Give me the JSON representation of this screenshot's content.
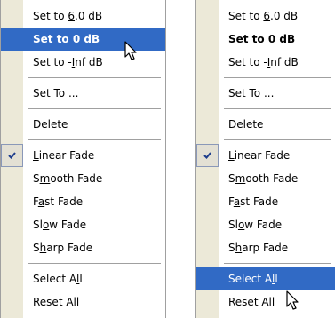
{
  "left_menu": {
    "items": [
      {
        "pre": "Set to ",
        "acc": "6",
        "post": ".0 dB"
      },
      {
        "pre": "Set to ",
        "acc": "0",
        "post": " dB"
      },
      {
        "pre": "Set to -",
        "acc": "I",
        "post": "nf dB"
      },
      {
        "pre": "Set To ...",
        "acc": "",
        "post": ""
      },
      {
        "pre": "Delete",
        "acc": "",
        "post": ""
      },
      {
        "pre": "",
        "acc": "L",
        "post": "inear Fade"
      },
      {
        "pre": "S",
        "acc": "m",
        "post": "ooth Fade"
      },
      {
        "pre": "F",
        "acc": "a",
        "post": "st Fade"
      },
      {
        "pre": "Sl",
        "acc": "o",
        "post": "w Fade"
      },
      {
        "pre": "S",
        "acc": "h",
        "post": "arp Fade"
      },
      {
        "pre": "Select A",
        "acc": "l",
        "post": "l"
      },
      {
        "pre": "Reset All",
        "acc": "",
        "post": ""
      }
    ]
  },
  "right_menu": {
    "items": [
      {
        "pre": "Set to ",
        "acc": "6",
        "post": ".0 dB"
      },
      {
        "pre": "Set to ",
        "acc": "0",
        "post": " dB"
      },
      {
        "pre": "Set to -",
        "acc": "I",
        "post": "nf dB"
      },
      {
        "pre": "Set To ...",
        "acc": "",
        "post": ""
      },
      {
        "pre": "Delete",
        "acc": "",
        "post": ""
      },
      {
        "pre": "",
        "acc": "L",
        "post": "inear Fade"
      },
      {
        "pre": "S",
        "acc": "m",
        "post": "ooth Fade"
      },
      {
        "pre": "F",
        "acc": "a",
        "post": "st Fade"
      },
      {
        "pre": "Sl",
        "acc": "o",
        "post": "w Fade"
      },
      {
        "pre": "S",
        "acc": "h",
        "post": "arp Fade"
      },
      {
        "pre": "Select A",
        "acc": "l",
        "post": "l"
      },
      {
        "pre": "Reset All",
        "acc": "",
        "post": ""
      }
    ]
  },
  "icons": {
    "checkmark": "check-icon",
    "pointer": "mouse-cursor-icon"
  },
  "colors": {
    "highlight": "#316ac5",
    "gutter": "#ece9d8",
    "separator": "#a0a0a0"
  }
}
